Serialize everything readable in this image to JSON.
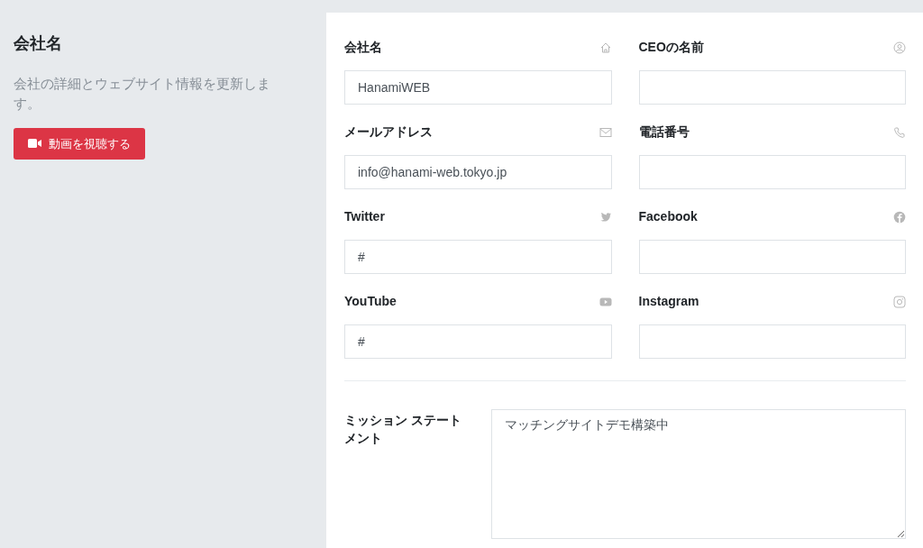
{
  "intro": {
    "title": "会社名",
    "description": "会社の詳細とウェブサイト情報を更新します。",
    "button": "動画を視聴する"
  },
  "fields": [
    {
      "label": "会社名",
      "kind": "home",
      "value": "HanamiWEB"
    },
    {
      "label": "CEOの名前",
      "kind": "user"
    },
    {
      "label": "メールアドレス",
      "kind": "mail",
      "value": "info@hanami-web.tokyo.jp"
    },
    {
      "label": "電話番号",
      "kind": "phone"
    },
    {
      "label": "Twitter",
      "kind": "bird",
      "value": "#"
    },
    {
      "label": "Facebook",
      "kind": "fcircle"
    },
    {
      "label": "YouTube",
      "kind": "play",
      "value": "#"
    },
    {
      "label": "Instagram",
      "kind": "camera"
    }
  ],
  "mission": {
    "label": "ミッション ステートメント",
    "value": "マッチングサイトデモ構築中"
  }
}
